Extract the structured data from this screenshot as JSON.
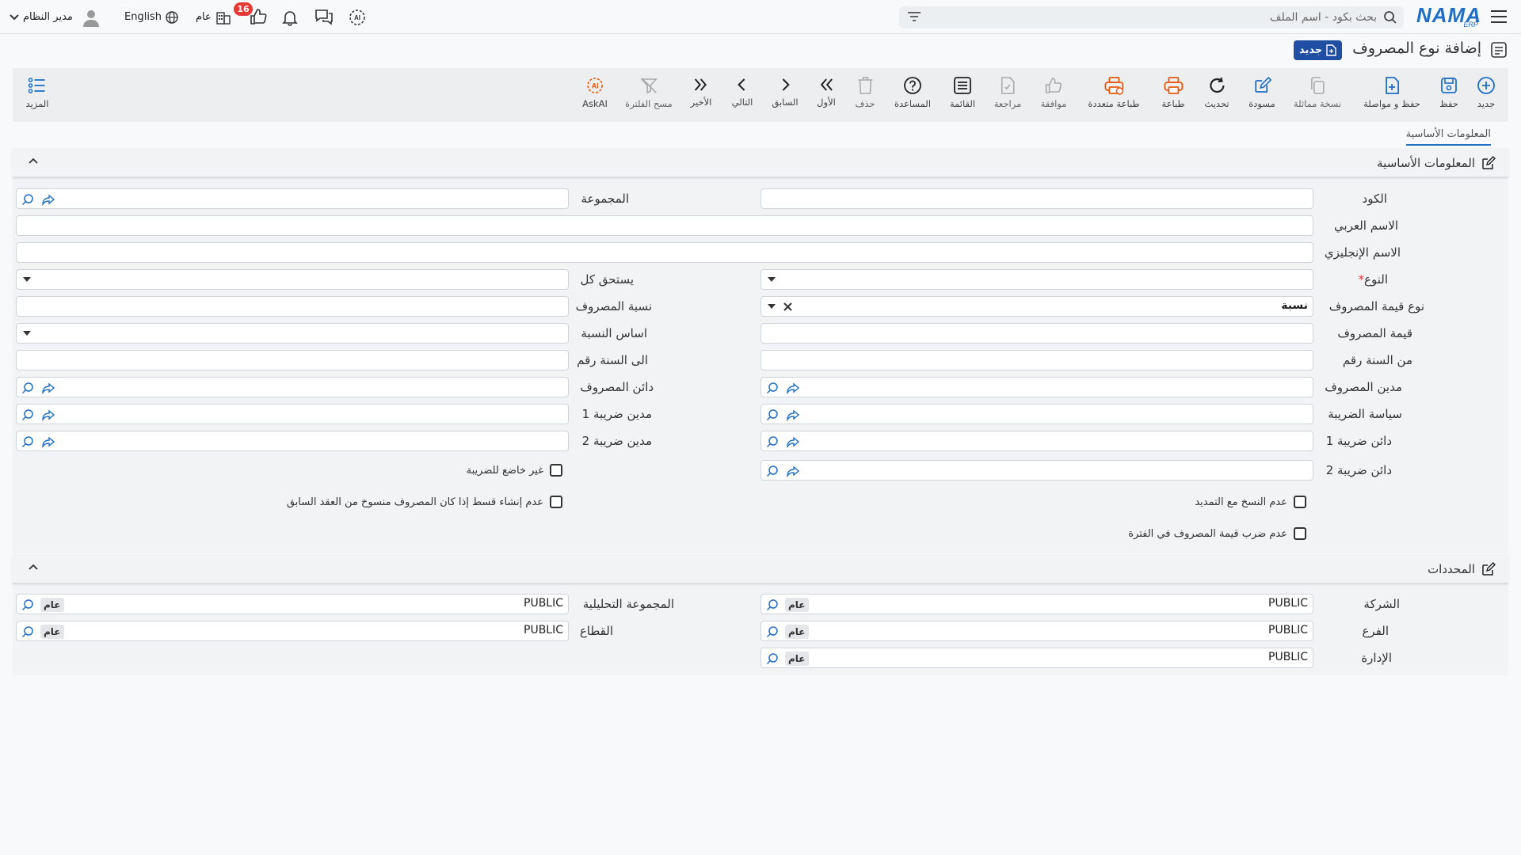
{
  "topbar": {
    "user": "مدير النظام",
    "language": "English",
    "context": "عام",
    "notif_count": "16",
    "search_placeholder": "بحث بكود - اسم الملف",
    "logo": "NAMA",
    "logo_sub": "ERP"
  },
  "page": {
    "title": "إضافة نوع المصروف",
    "badge": "جديد"
  },
  "toolbar": {
    "new": "جديد",
    "save": "حفظ",
    "save_continue": "حفظ و مواصلة",
    "duplicate": "نسخة مماثلة",
    "draft": "مسودة",
    "refresh": "تحديث",
    "print": "طباعة",
    "multi_print": "طباعة متعددة",
    "review": "مراجعة",
    "approve": "موافقة",
    "list": "القائمة",
    "help": "المساعدة",
    "delete": "حذف",
    "first": "الأول",
    "prev": "السابق",
    "next": "التالي",
    "last": "الأخير",
    "clear_filter": "مسح الفلترة",
    "askai": "AskAI",
    "more": "المزيد"
  },
  "tabs": {
    "basic": "المعلومات الأساسية"
  },
  "section_basic": {
    "title": "المعلومات الأساسية",
    "code_label": "الكود",
    "group_label": "المجموعة",
    "arabic_name_label": "الاسم العربي",
    "english_name_label": "الاسم الإنجليزي",
    "type_label": "النوع",
    "type_required": "*",
    "due_every_label": "يستحق كل",
    "value_type_label": "نوع قيمة المصروف",
    "value_type_value": "نسبة",
    "ratio_label": "نسبة المصروف",
    "value_label": "قيمة المصروف",
    "ratio_basis_label": "اساس النسبة",
    "from_year_label": "من السنة رقم",
    "to_year_label": "الى السنة رقم",
    "debit_label": "مدين المصروف",
    "credit_label": "دائن المصروف",
    "tax_policy_label": "سياسة الضريبة",
    "tax_debit1_label": "مدين ضريبة 1",
    "tax_credit1_label": "دائن ضريبة 1",
    "tax_debit2_label": "مدين ضريبة 2",
    "tax_credit2_label": "دائن ضريبة 2",
    "not_taxable_label": "غير خاضع للضريبة",
    "no_copy_renew_label": "عدم النسخ مع التمديد",
    "no_installment_label": "عدم إنشاء قسط إذا كان المصروف منسوخ من العقد السابق",
    "no_multiply_label": "عدم ضرب قيمة المصروف في الفترة"
  },
  "section_dims": {
    "title": "المحددات",
    "company_label": "الشركة",
    "company_value": "PUBLIC",
    "analytic_group_label": "المجموعة التحليلية",
    "analytic_group_value": "PUBLIC",
    "branch_label": "الفرع",
    "branch_value": "PUBLIC",
    "sector_label": "القطاع",
    "sector_value": "PUBLIC",
    "department_label": "الإدارة",
    "department_value": "PUBLIC",
    "tag": "عام"
  },
  "colors": {
    "brand": "#1f6fc5",
    "badge": "#1f4ea3",
    "print_icon": "#e8590c",
    "notif": "#e53935"
  }
}
